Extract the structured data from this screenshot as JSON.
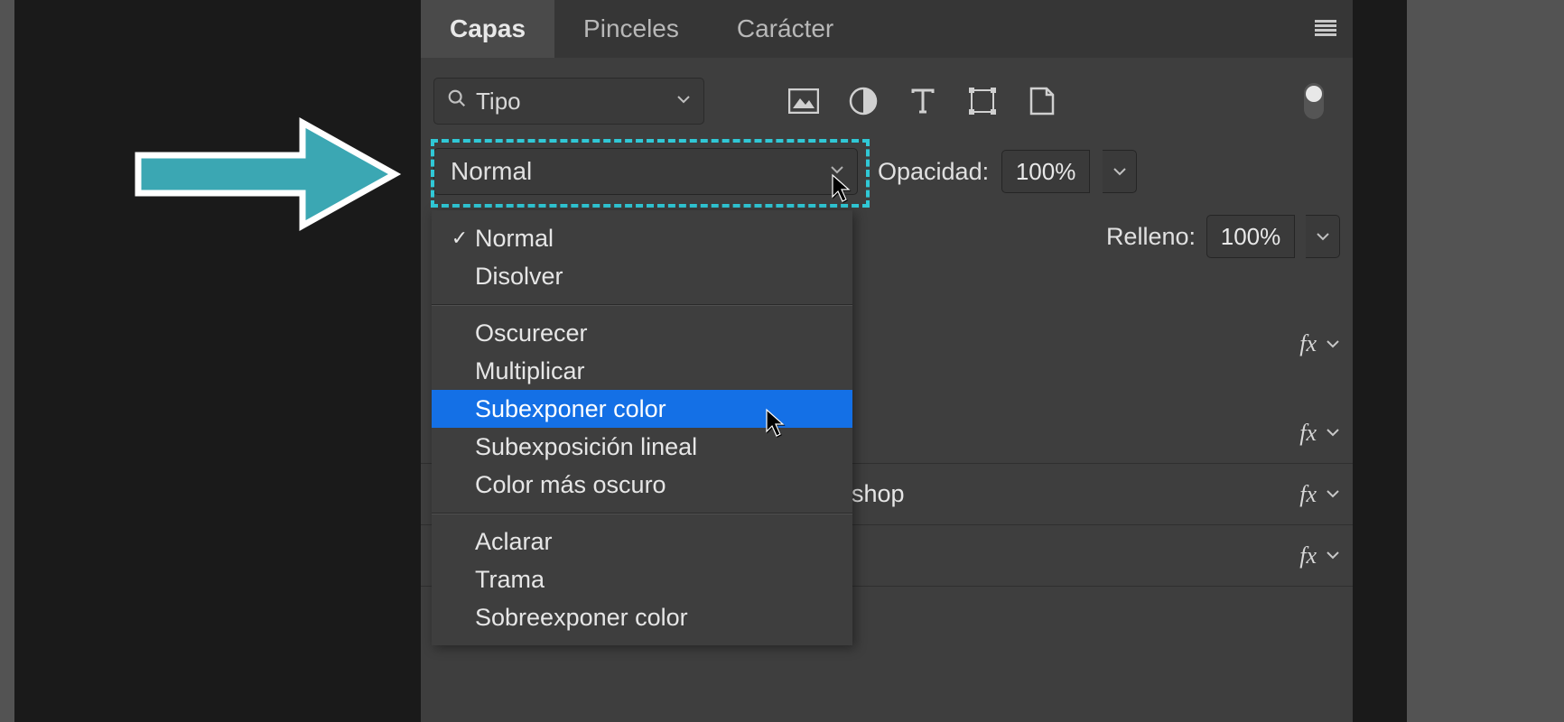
{
  "tabs": {
    "capas": "Capas",
    "pinceles": "Pinceles",
    "caracter": "Carácter"
  },
  "filter": {
    "label": "Tipo"
  },
  "blend": {
    "current": "Normal"
  },
  "opacity": {
    "label": "Opacidad:",
    "value": "100%"
  },
  "fill": {
    "label": "Relleno:",
    "value": "100%"
  },
  "menu": {
    "group1": {
      "normal": "Normal",
      "disolver": "Disolver"
    },
    "group2": {
      "oscurecer": "Oscurecer",
      "multiplicar": "Multiplicar",
      "subexponer_color": "Subexponer color",
      "subexposicion_lineal": "Subexposición lineal",
      "color_mas_oscuro": "Color más oscuro"
    },
    "group3": {
      "aclarar": "Aclarar",
      "trama": "Trama",
      "sobreexponer_color": "Sobreexponer color"
    }
  },
  "layers": {
    "fragment": "oshop",
    "fx": "fx"
  },
  "colors": {
    "highlight_dash": "#30c8d6",
    "arrow_fill": "#3ba7b3",
    "menu_hover": "#1470e6"
  }
}
